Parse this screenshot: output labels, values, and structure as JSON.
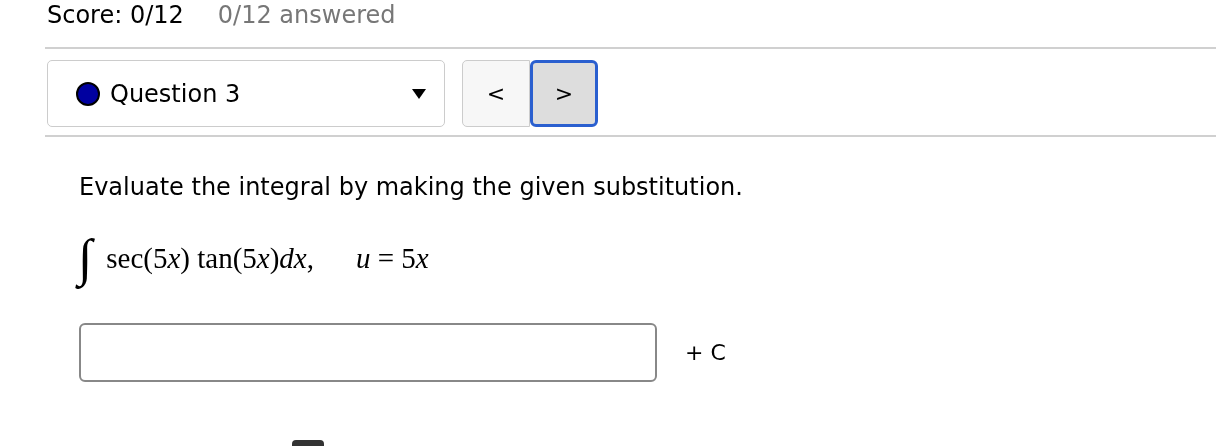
{
  "score": {
    "label": "Score: 0/12",
    "answered": "0/12 answered"
  },
  "question_select": {
    "label": "Question 3",
    "color": "#0000a0"
  },
  "nav": {
    "previous": "<",
    "next": ">",
    "next_focused": true
  },
  "question": {
    "prompt": "Evaluate the integral by making the given substitution.",
    "integral_sign": "∫",
    "integrand": [
      {
        "text": "sec(5",
        "italic": false
      },
      {
        "text": "x",
        "italic": true
      },
      {
        "text": ") tan(5",
        "italic": false
      },
      {
        "text": "x",
        "italic": true
      },
      {
        "text": ")",
        "italic": false
      },
      {
        "text": "dx",
        "italic": true
      },
      {
        "text": ",",
        "italic": false
      }
    ],
    "substitution": [
      {
        "text": "u",
        "italic": true
      },
      {
        "text": " = 5",
        "italic": false
      },
      {
        "text": "x",
        "italic": true
      }
    ]
  },
  "answer": {
    "suffix": "+ C"
  }
}
